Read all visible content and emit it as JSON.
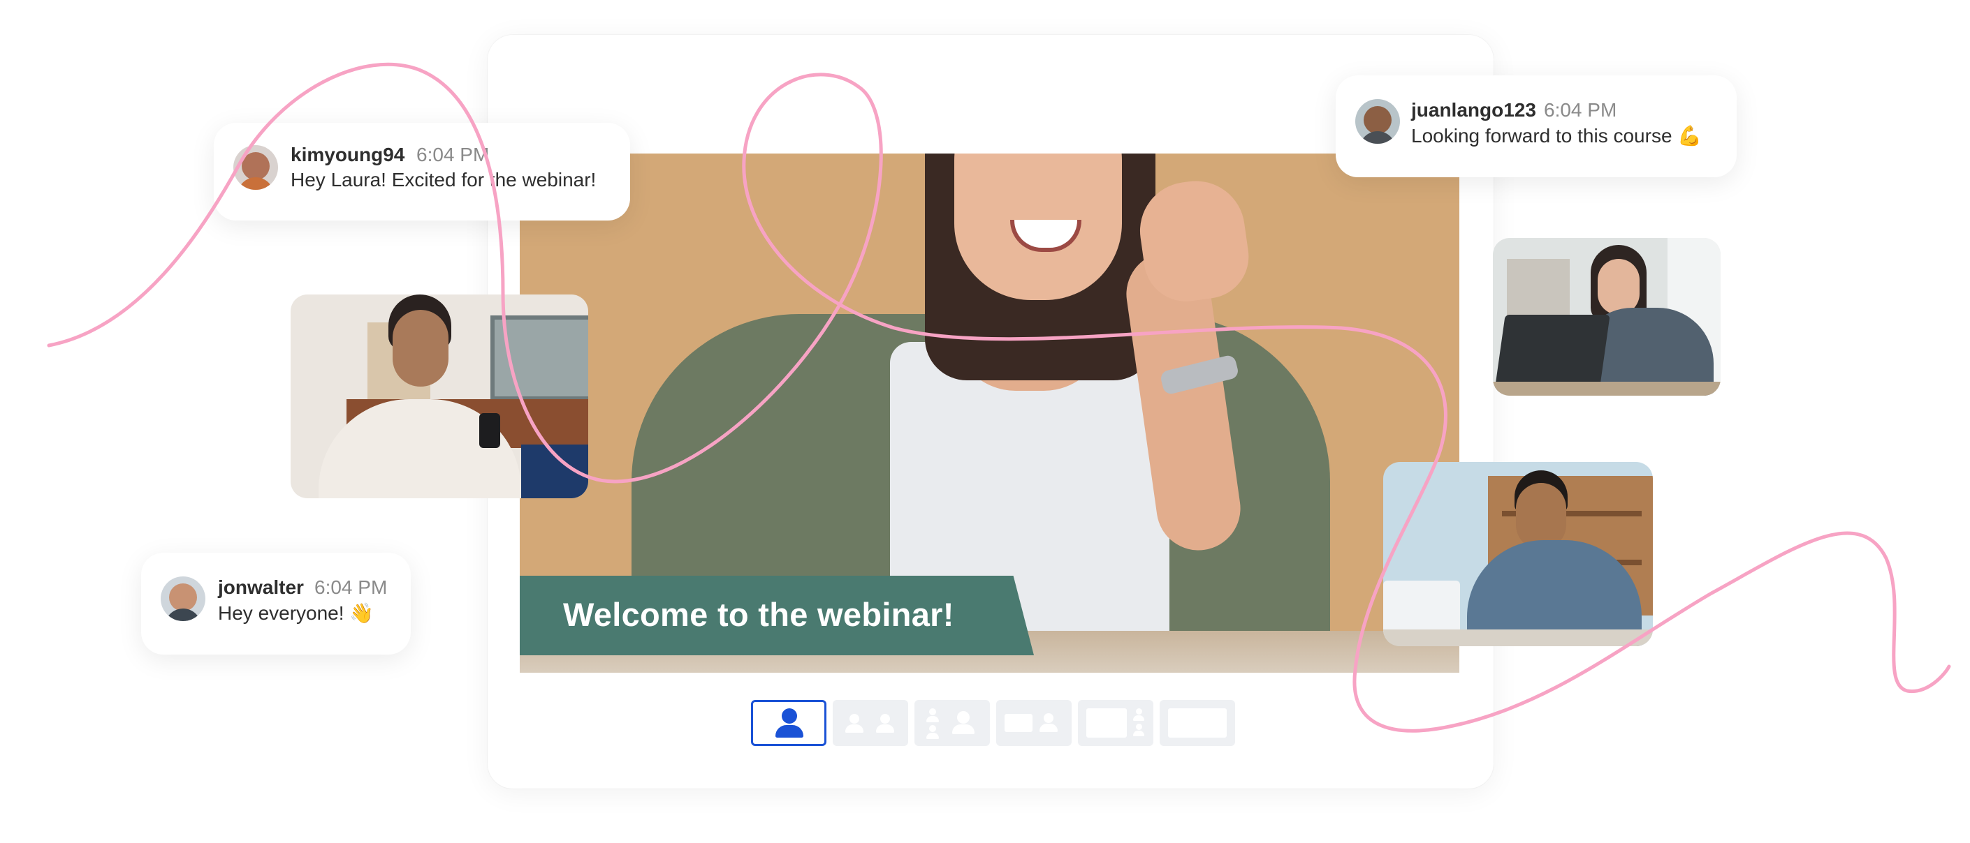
{
  "webinar": {
    "banner_text": "Welcome to the webinar!"
  },
  "layout_options": [
    {
      "name": "single-speaker",
      "active": true
    },
    {
      "name": "two-speakers",
      "active": false
    },
    {
      "name": "speaker-and-guest",
      "active": false
    },
    {
      "name": "screen-and-speaker",
      "active": false
    },
    {
      "name": "screen-and-small-speaker",
      "active": false
    },
    {
      "name": "screen-only",
      "active": false
    }
  ],
  "chat_messages": [
    {
      "username": "kimyoung94",
      "time": "6:04 PM",
      "message": "Hey Laura! Excited for the webinar!"
    },
    {
      "username": "juanlango123",
      "time": "6:04 PM",
      "message": "Looking forward to this course 💪"
    },
    {
      "username": "jonwalter",
      "time": "6:04 PM",
      "message": "Hey everyone! 👋"
    }
  ],
  "colors": {
    "banner": "#4a7a70",
    "stage_background": "#d3a877",
    "accent": "#1a52d6",
    "decorative_line": "#f7a3c4"
  }
}
